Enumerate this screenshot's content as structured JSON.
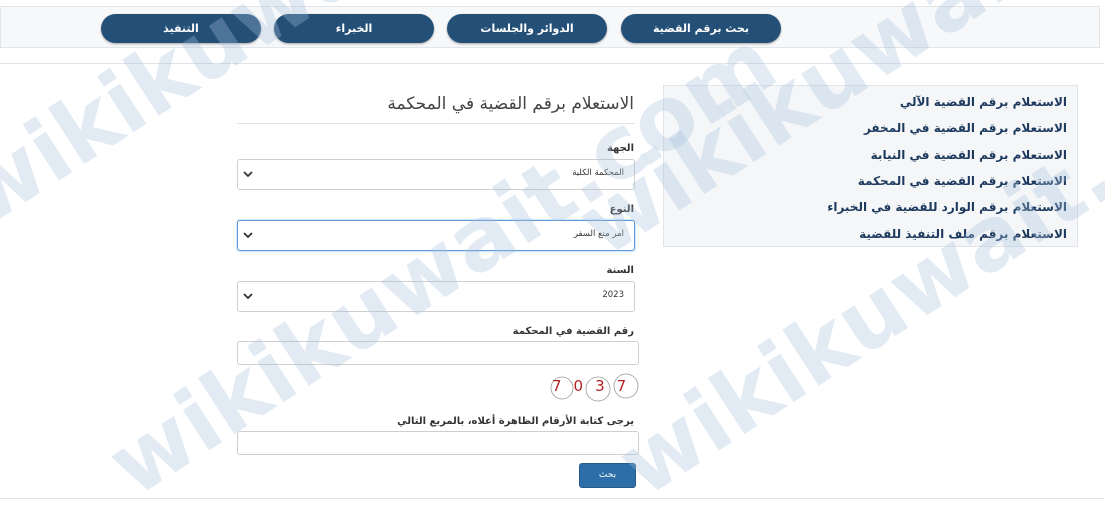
{
  "top_tabs": [
    {
      "label": "بحث برقم القضية"
    },
    {
      "label": "الدوائر والجلسات"
    },
    {
      "label": "الخبراء"
    },
    {
      "label": "التنفيذ"
    }
  ],
  "sidebar": {
    "links": [
      {
        "label": "الاستعلام برقم القضية الآلي"
      },
      {
        "label": "الاستعلام برقم القضية في المخفر"
      },
      {
        "label": "الاستعلام برقم القضية في النيابة"
      },
      {
        "label": "الاستعلام برقم القضية في المحكمة"
      },
      {
        "label": "الاستعلام برقم الوارد للقضية في الخبراء"
      },
      {
        "label": "الاستعلام برقم ملف التنفيذ للقضية"
      }
    ]
  },
  "form": {
    "title": "الاستعلام برقم القضية في المحكمة",
    "authority": {
      "label": "الجهة",
      "value": "المحكمة الكلية"
    },
    "type": {
      "label": "النوع",
      "value": "امر منع السفر"
    },
    "year": {
      "label": "السنة",
      "value": "2023"
    },
    "case_number": {
      "label": "رقم القضية في المحكمة",
      "value": ""
    },
    "captcha": {
      "digits": "7037"
    },
    "captcha_input": {
      "label": "يرجى كتابة الأرقام الظاهرة أعلاه، بالمربع التالي",
      "value": ""
    },
    "submit_label": "بحث"
  },
  "watermark": {
    "text": "wikikuwait.com"
  },
  "colors": {
    "tab_bg": "#245078",
    "link_text": "#1d3a5e",
    "button_bg": "#2e6ea8",
    "captcha_digits": "#b22222"
  }
}
